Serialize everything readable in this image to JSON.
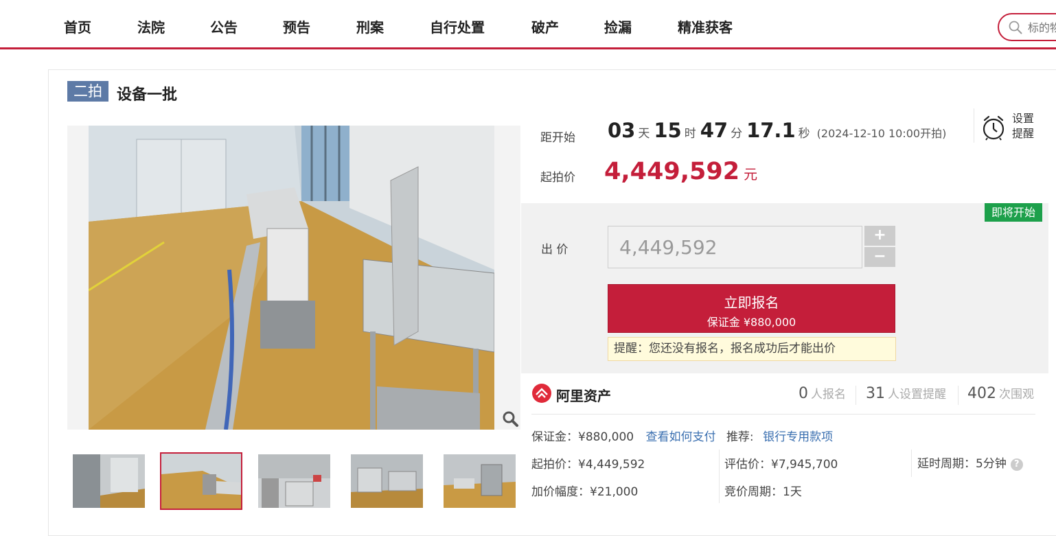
{
  "nav": {
    "items": [
      "首页",
      "法院",
      "公告",
      "预告",
      "刑案",
      "自行处置",
      "破产",
      "捡漏",
      "精准获客"
    ],
    "search_placeholder": "标的物"
  },
  "item": {
    "round_badge": "二拍",
    "title": "设备一批"
  },
  "countdown": {
    "label": "距开始",
    "days": "03",
    "days_unit": "天",
    "hours": "15",
    "hours_unit": "时",
    "minutes": "47",
    "minutes_unit": "分",
    "seconds": "17.1",
    "seconds_unit": "秒",
    "start_time": "(2024-12-10 10:00开拍)"
  },
  "alarm": {
    "line1": "设置",
    "line2": "提醒"
  },
  "start_price": {
    "label": "起拍价",
    "amount": "4,449,592",
    "currency": "元"
  },
  "bid": {
    "label": "出 价",
    "input_value": "4,449,592",
    "plus": "+",
    "minus": "−",
    "status_tag": "即将开始",
    "signup_label": "立即报名",
    "deposit_label": "保证金 ¥880,000",
    "reminder": "提醒：您还没有报名，报名成功后才能出价"
  },
  "stats": {
    "platform": "阿里资产",
    "signups": "0",
    "signups_label": "人报名",
    "reminders": "31",
    "reminders_label": "人设置提醒",
    "views": "402",
    "views_label": "次围观"
  },
  "details": {
    "deposit": "保证金：¥880,000",
    "how_to_pay": "查看如何支付",
    "recommend_label": "推荐:",
    "recommend_link": "银行专用款项",
    "start_price": "起拍价：¥4,449,592",
    "appraisal": "评估价：¥7,945,700",
    "delay": "延时周期：5分钟",
    "increment": "加价幅度：¥21,000",
    "period": "竞价周期：1天"
  },
  "colors": {
    "accent": "#c41e3a",
    "badge": "#5d7aa6",
    "status_green": "#1da04b",
    "link": "#3a6fb0"
  },
  "icons": {
    "search": "search-icon",
    "alarm": "alarm-clock-icon",
    "zoom": "zoom-icon",
    "help": "help-icon",
    "platform_logo": "ali-asset-logo"
  },
  "gallery": {
    "active_thumb": 2,
    "thumb_count": 5
  }
}
